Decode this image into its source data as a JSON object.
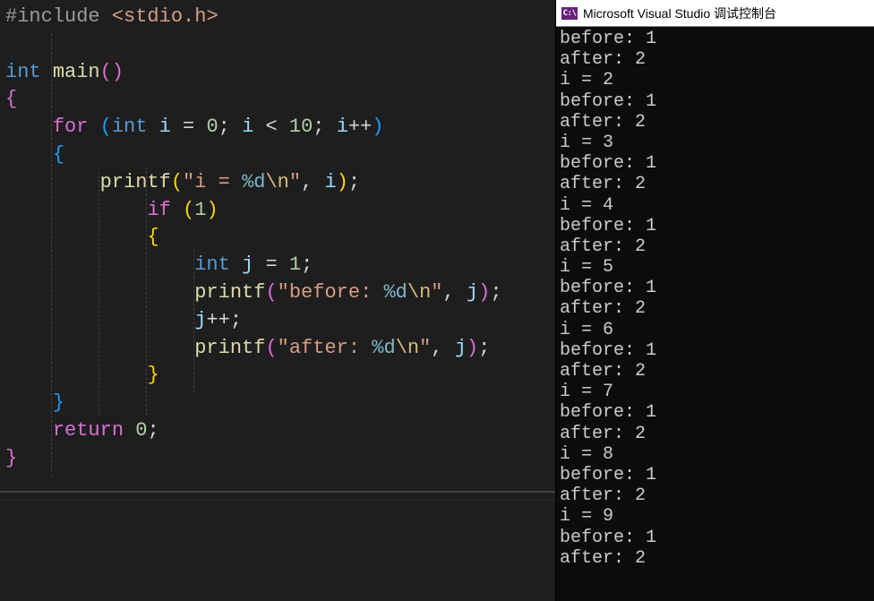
{
  "console": {
    "badge": "C:\\",
    "title": "Microsoft Visual Studio 调试控制台",
    "lines": [
      "before: 1",
      "after: 2",
      "i = 2",
      "before: 1",
      "after: 2",
      "i = 3",
      "before: 1",
      "after: 2",
      "i = 4",
      "before: 1",
      "after: 2",
      "i = 5",
      "before: 1",
      "after: 2",
      "i = 6",
      "before: 1",
      "after: 2",
      "i = 7",
      "before: 1",
      "after: 2",
      "i = 8",
      "before: 1",
      "after: 2",
      "i = 9",
      "before: 1",
      "after: 2"
    ]
  },
  "code": {
    "include_directive": "#include",
    "include_header": "<stdio.h>",
    "kw_int": "int",
    "fn_main": "main",
    "kw_for": "for",
    "var_i": "i",
    "op_assign": "=",
    "num_0": "0",
    "op_lt": "<",
    "num_10": "10",
    "op_inc": "++",
    "fn_printf": "printf",
    "str_i_prefix": "\"i = ",
    "fmt_d": "%d",
    "esc_n": "\\n",
    "str_close": "\"",
    "kw_if": "if",
    "num_1": "1",
    "var_j": "j",
    "str_before_prefix": "\"before: ",
    "str_after_prefix": "\"after: ",
    "kw_return": "return",
    "semicolon": ";",
    "comma": ",",
    "lparen": "(",
    "rparen": ")",
    "lbrace": "{",
    "rbrace": "}"
  }
}
